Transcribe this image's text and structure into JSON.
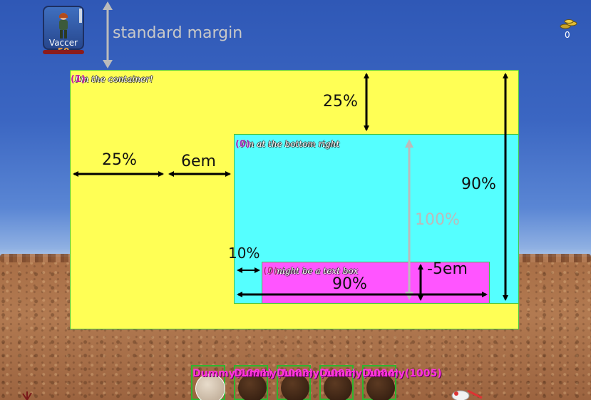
{
  "hero": {
    "name": "Vaccer",
    "level": "50"
  },
  "margin_label": "standard margin",
  "gold": {
    "count": "0",
    "icon": "gold-coins-icon"
  },
  "boxes": [
    {
      "tag": "(1)",
      "title": "I'm the container!"
    },
    {
      "tag": "(0)",
      "title": "I'm at the bottom right"
    },
    {
      "tag": "(0)",
      "title": "I might be a text box"
    }
  ],
  "dimensions": {
    "container_top": "25%",
    "container_height": "90%",
    "left_percent": "25%",
    "left_em": "6em",
    "inner_height": "100%",
    "textbox_left": "10%",
    "textbox_width": "90%",
    "textbox_bottom": "-5em"
  },
  "slots": [
    {
      "label": "Dummy(1001)"
    },
    {
      "label": "Dummy(1002)"
    },
    {
      "label": "Dummy(1003)"
    },
    {
      "label": "Dummy(1004)"
    },
    {
      "label": "Dummy(1005)"
    }
  ],
  "colors": {
    "container": "#ffff55",
    "bottom_right": "#55ffff",
    "textbox": "#ff55ff",
    "border": "#44c444",
    "slot_label": "#ff33dd"
  }
}
